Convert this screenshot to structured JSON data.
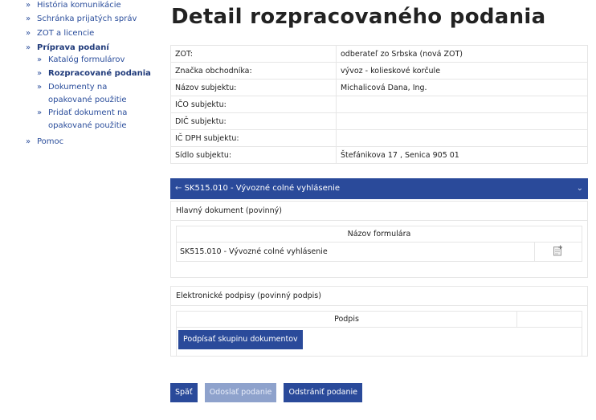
{
  "sidebar": {
    "items": [
      {
        "label": "História komunikácie"
      },
      {
        "label": "Schránka prijatých správ"
      },
      {
        "label": "ZOT a licencie"
      },
      {
        "label": "Príprava podaní"
      },
      {
        "label": "Katalóg formulárov"
      },
      {
        "label": "Rozpracované podania"
      },
      {
        "label": "Dokumenty na opakované použitie"
      },
      {
        "label": "Pridať dokument na opakované použitie"
      },
      {
        "label": "Pomoc"
      }
    ]
  },
  "page": {
    "title": "Detail rozpracovaného podania"
  },
  "info": {
    "rows": [
      {
        "key": "ZOT:",
        "value": "odberateľ zo Srbska (nová ZOT)"
      },
      {
        "key": "Značka obchodníka:",
        "value": "vývoz - kolieskové korčule"
      },
      {
        "key": "Názov subjektu:",
        "value": "Michalicová Dana, Ing."
      },
      {
        "key": "IČO subjektu:",
        "value": ""
      },
      {
        "key": "DIČ subjektu:",
        "value": ""
      },
      {
        "key": "IČ DPH subjektu:",
        "value": ""
      },
      {
        "key": "Sídlo subjektu:",
        "value": "Štefánikova 17 , Senica 905 01"
      }
    ]
  },
  "section": {
    "header": "SK515.010 - Vývozné colné vyhlásenie",
    "main_doc": {
      "title": "Hlavný dokument (povinný)",
      "column": "Názov formulára",
      "row": "SK515.010 - Vývozné colné vyhlásenie"
    },
    "signatures": {
      "title": "Elektronické podpisy (povinný podpis)",
      "column": "Podpis",
      "button": "Podpísať skupinu dokumentov"
    }
  },
  "footer": {
    "back": "Späť",
    "send": "Odoslať podanie",
    "remove": "Odstrániť podanie"
  },
  "colors": {
    "primary": "#2a4a9a",
    "disabled": "#8ea2cc"
  }
}
